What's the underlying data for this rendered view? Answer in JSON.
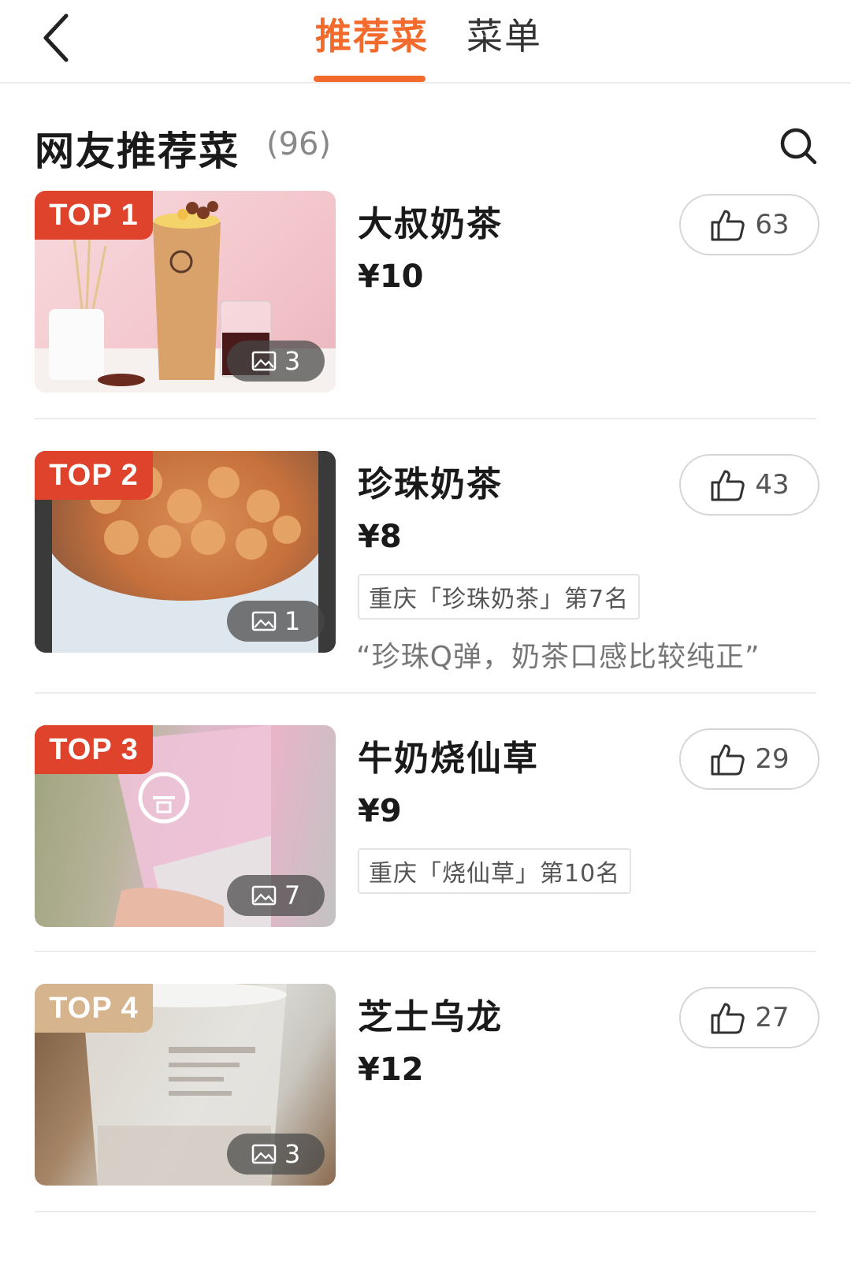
{
  "nav": {
    "back_icon": "chevron-left-icon",
    "tabs": [
      {
        "label": "推荐菜",
        "active": true
      },
      {
        "label": "菜单",
        "active": false
      }
    ],
    "accent_color": "#f26a2c"
  },
  "section": {
    "title": "网友推荐菜",
    "count": "(96)",
    "search_icon": "search-icon"
  },
  "dishes": [
    {
      "rank": "TOP 1",
      "name": "大叔奶茶",
      "price": "¥10",
      "likes": "63",
      "photos": "3",
      "rank_tag": "",
      "quote": "",
      "badge_color": "#e0432b"
    },
    {
      "rank": "TOP 2",
      "name": "珍珠奶茶",
      "price": "¥8",
      "likes": "43",
      "photos": "1",
      "rank_tag": "重庆「珍珠奶茶」第7名",
      "quote": "“珍珠Q弹，奶茶口感比较纯正”",
      "badge_color": "#e0432b"
    },
    {
      "rank": "TOP 3",
      "name": "牛奶烧仙草",
      "price": "¥9",
      "likes": "29",
      "photos": "7",
      "rank_tag": "重庆「烧仙草」第10名",
      "quote": "",
      "badge_color": "#e0432b"
    },
    {
      "rank": "TOP 4",
      "name": "芝士乌龙",
      "price": "¥12",
      "likes": "27",
      "photos": "3",
      "rank_tag": "",
      "quote": "",
      "badge_color": "#d6b48e"
    }
  ]
}
